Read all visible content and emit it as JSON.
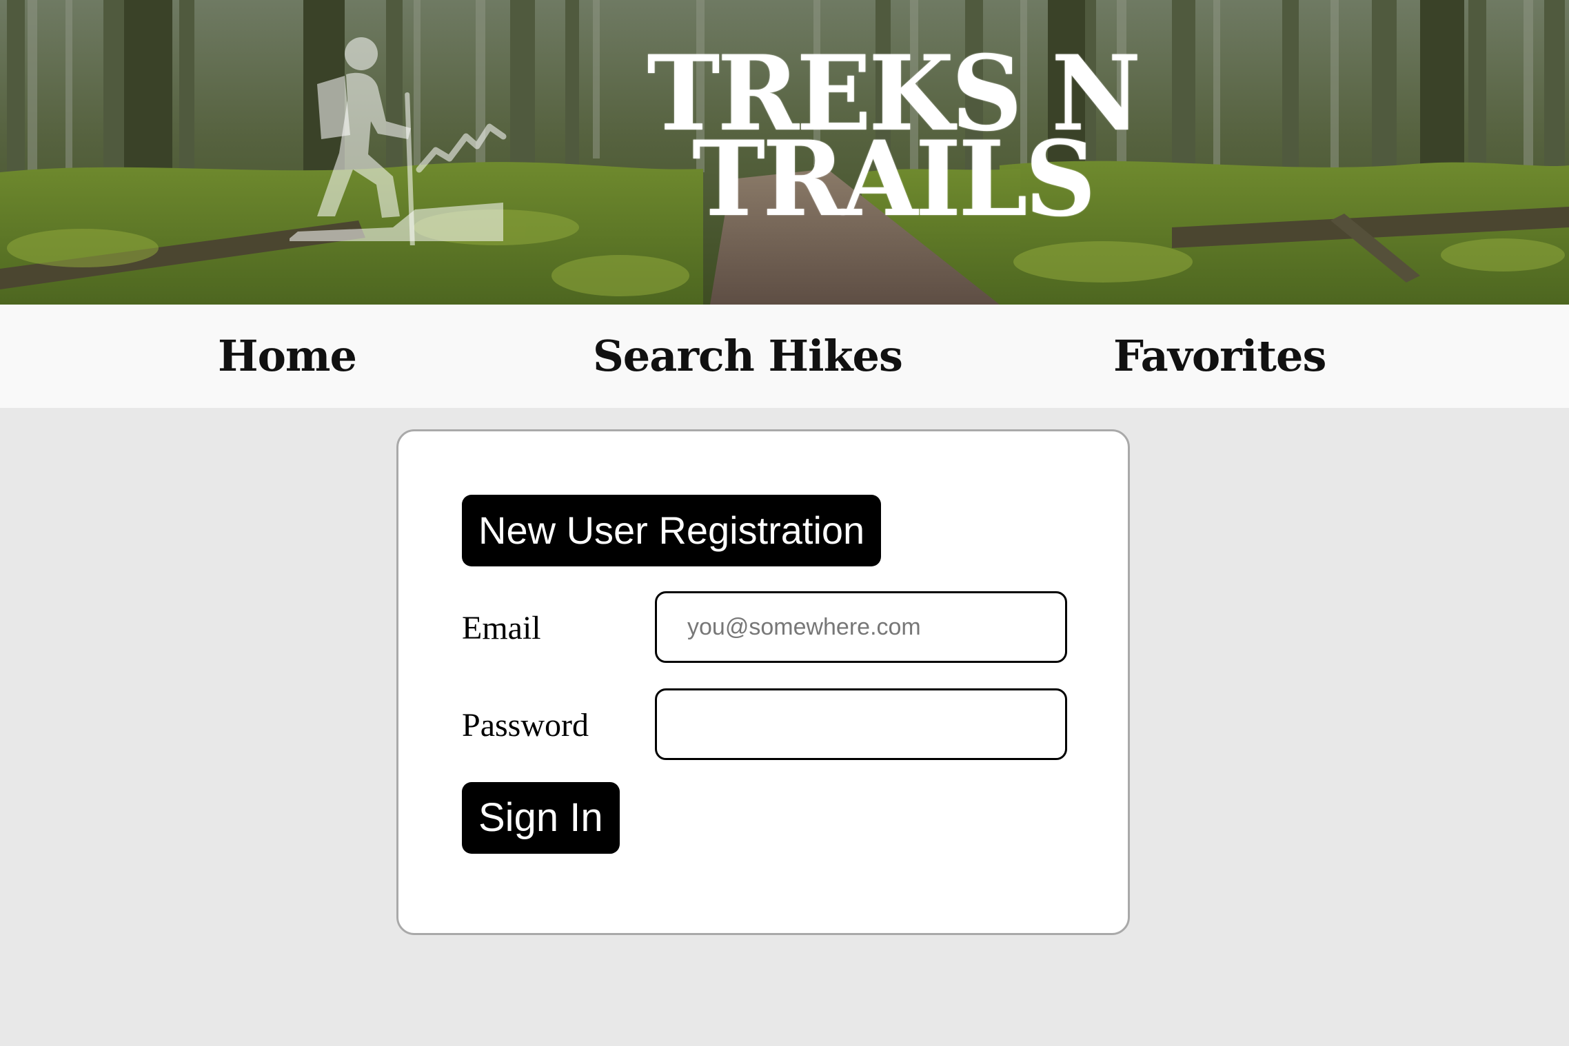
{
  "header": {
    "title_line1": "TREKS N",
    "title_line2": "TRAILS",
    "logo_icon": "hiker-mountain-icon",
    "background": "forest-trail-photo"
  },
  "nav": {
    "items": [
      {
        "label": "Home"
      },
      {
        "label": "Search Hikes"
      },
      {
        "label": "Favorites"
      }
    ]
  },
  "login_form": {
    "register_button_label": "New User Registration",
    "email_label": "Email",
    "email_placeholder": "you@somewhere.com",
    "email_value": "",
    "password_label": "Password",
    "password_value": "",
    "signin_button_label": "Sign In"
  },
  "colors": {
    "page_background": "#e8e8e8",
    "nav_background": "#f9f9f9",
    "card_background": "#ffffff",
    "button_background": "#000000",
    "button_text": "#ffffff"
  }
}
